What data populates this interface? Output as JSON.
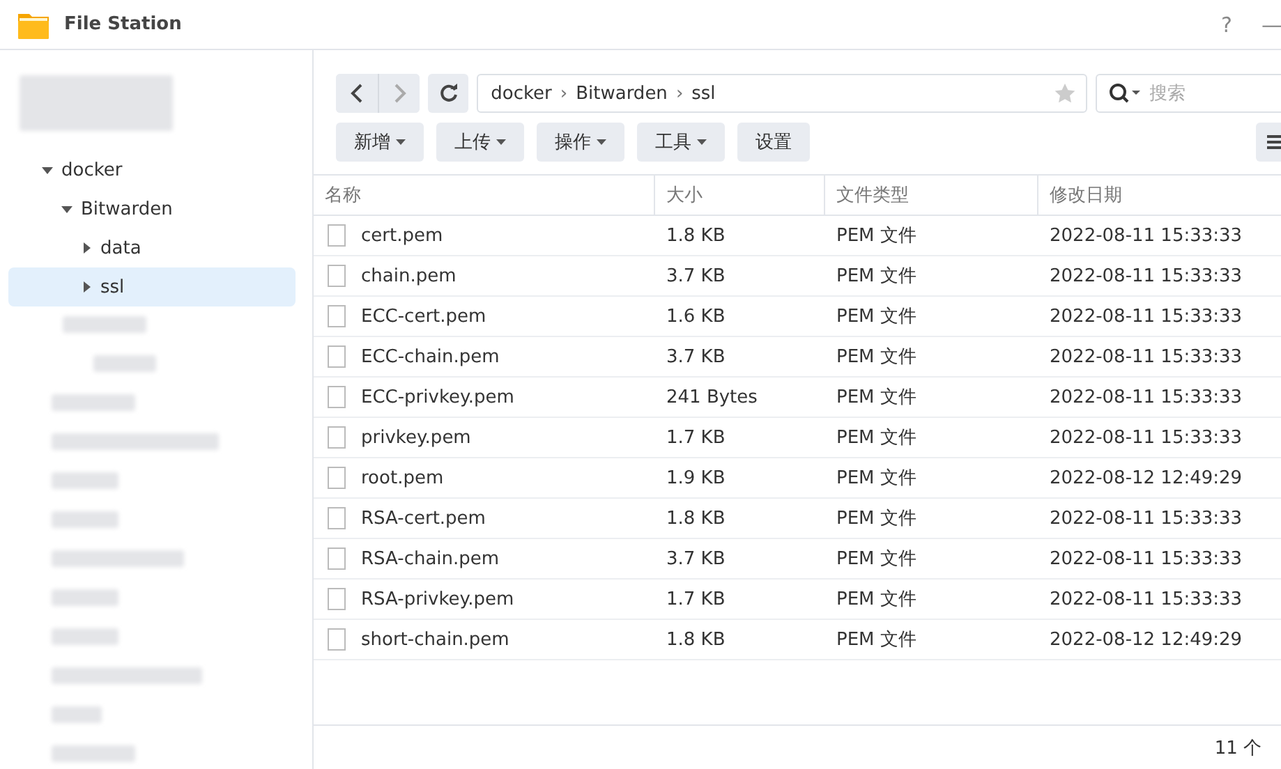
{
  "window": {
    "title": "File Station",
    "controls": [
      "?",
      "—"
    ]
  },
  "sidebar": {
    "tree": [
      {
        "label": "docker",
        "expanded": true,
        "selected": false,
        "children": [
          {
            "label": "Bitwarden",
            "expanded": true,
            "selected": false,
            "children": [
              {
                "label": "data",
                "expanded": false,
                "selected": false
              },
              {
                "label": "ssl",
                "expanded": false,
                "selected": true
              }
            ]
          }
        ]
      }
    ]
  },
  "path": {
    "segments": [
      "docker",
      "Bitwarden",
      "ssl"
    ],
    "separator": "›",
    "favorite": false
  },
  "search": {
    "placeholder": "搜索"
  },
  "toolbar": [
    {
      "label": "新增",
      "dropdown": true
    },
    {
      "label": "上传",
      "dropdown": true
    },
    {
      "label": "操作",
      "dropdown": true
    },
    {
      "label": "工具",
      "dropdown": true
    },
    {
      "label": "设置",
      "dropdown": false
    }
  ],
  "table": {
    "columns": [
      "名称",
      "大小",
      "文件类型",
      "修改日期"
    ],
    "rows": [
      {
        "name": "cert.pem",
        "size": "1.8 KB",
        "type": "PEM 文件",
        "modified": "2022-08-11 15:33:33"
      },
      {
        "name": "chain.pem",
        "size": "3.7 KB",
        "type": "PEM 文件",
        "modified": "2022-08-11 15:33:33"
      },
      {
        "name": "ECC-cert.pem",
        "size": "1.6 KB",
        "type": "PEM 文件",
        "modified": "2022-08-11 15:33:33"
      },
      {
        "name": "ECC-chain.pem",
        "size": "3.7 KB",
        "type": "PEM 文件",
        "modified": "2022-08-11 15:33:33"
      },
      {
        "name": "ECC-privkey.pem",
        "size": "241 Bytes",
        "type": "PEM 文件",
        "modified": "2022-08-11 15:33:33"
      },
      {
        "name": "privkey.pem",
        "size": "1.7 KB",
        "type": "PEM 文件",
        "modified": "2022-08-11 15:33:33"
      },
      {
        "name": "root.pem",
        "size": "1.9 KB",
        "type": "PEM 文件",
        "modified": "2022-08-12 12:49:29"
      },
      {
        "name": "RSA-cert.pem",
        "size": "1.8 KB",
        "type": "PEM 文件",
        "modified": "2022-08-11 15:33:33"
      },
      {
        "name": "RSA-chain.pem",
        "size": "3.7 KB",
        "type": "PEM 文件",
        "modified": "2022-08-11 15:33:33"
      },
      {
        "name": "RSA-privkey.pem",
        "size": "1.7 KB",
        "type": "PEM 文件",
        "modified": "2022-08-11 15:33:33"
      },
      {
        "name": "short-chain.pem",
        "size": "1.8 KB",
        "type": "PEM 文件",
        "modified": "2022-08-12 12:49:29"
      }
    ]
  },
  "status_bar": {
    "count": "11 个"
  }
}
